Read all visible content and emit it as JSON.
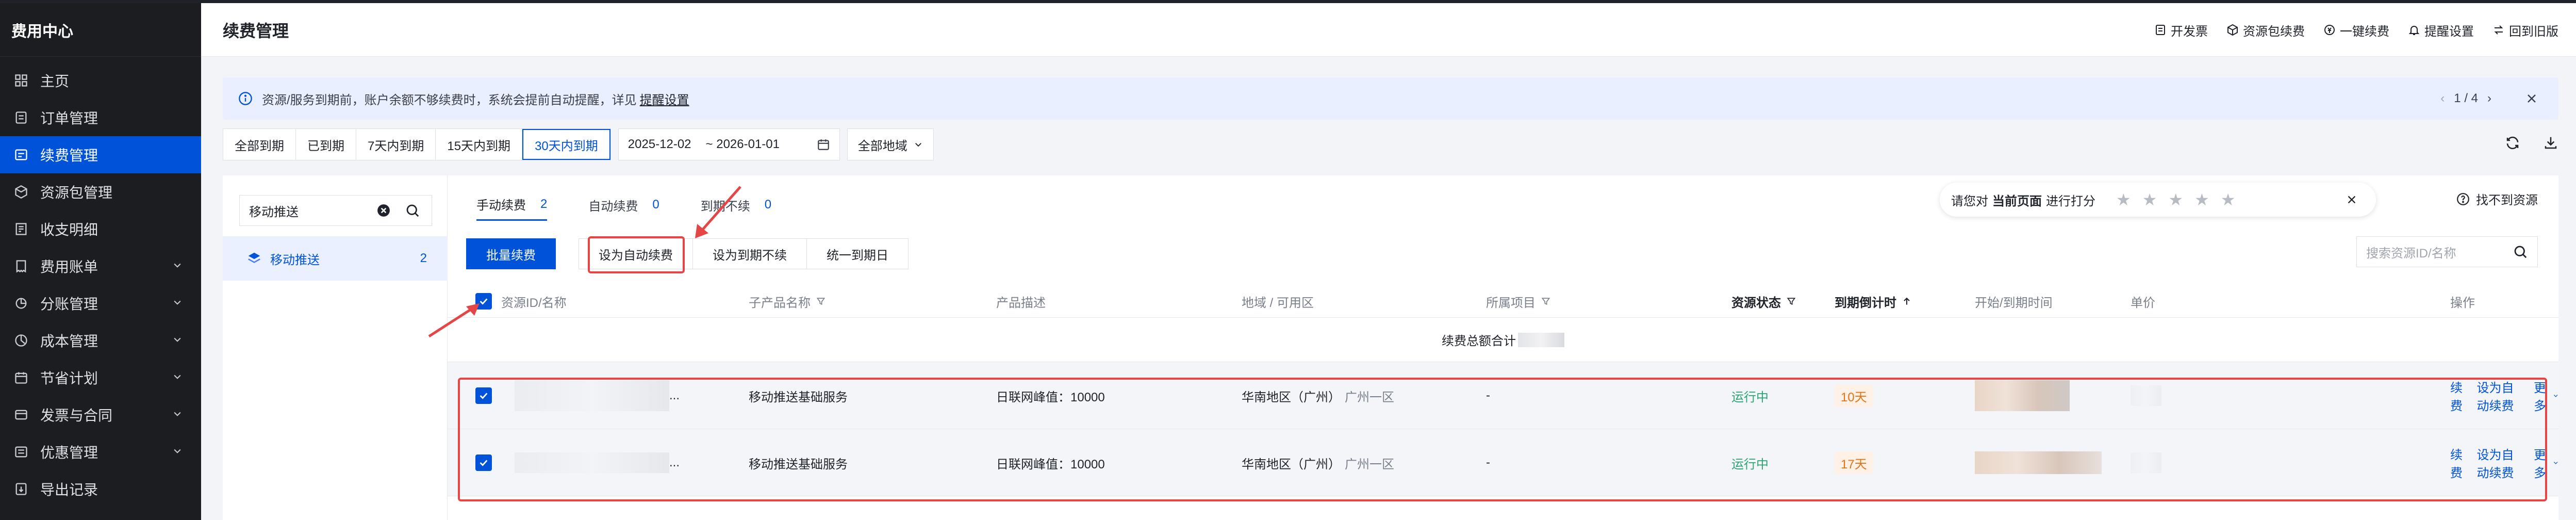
{
  "sidebar": {
    "title": "费用中心",
    "items": [
      {
        "label": "主页",
        "icon": "grid-icon"
      },
      {
        "label": "订单管理",
        "icon": "order-icon"
      },
      {
        "label": "续费管理",
        "icon": "renew-icon"
      },
      {
        "label": "资源包管理",
        "icon": "package-icon"
      },
      {
        "label": "收支明细",
        "icon": "ledger-icon"
      },
      {
        "label": "费用账单",
        "icon": "bill-icon"
      },
      {
        "label": "分账管理",
        "icon": "split-icon"
      },
      {
        "label": "成本管理",
        "icon": "cost-icon"
      },
      {
        "label": "节省计划",
        "icon": "plan-icon"
      },
      {
        "label": "发票与合同",
        "icon": "invoice-icon"
      },
      {
        "label": "优惠管理",
        "icon": "discount-icon"
      },
      {
        "label": "导出记录",
        "icon": "export-icon"
      }
    ]
  },
  "header": {
    "title": "续费管理",
    "actions": [
      "开发票",
      "资源包续费",
      "一键续费",
      "提醒设置",
      "回到旧版"
    ]
  },
  "notice": {
    "text": "资源/服务到期前，账户余额不够续费时，系统会提前自动提醒，详见",
    "link": "提醒设置",
    "pager": "1 / 4"
  },
  "filters": {
    "segments": [
      "全部到期",
      "已到期",
      "7天内到期",
      "15天内到期",
      "30天内到期"
    ],
    "active_segment": "30天内到期",
    "date_start": "2025-12-02",
    "date_end": "~ 2026-01-01",
    "region": "全部地域"
  },
  "left_panel": {
    "search_value": "移动推送",
    "product": "移动推送",
    "product_count": "2"
  },
  "tabs": [
    {
      "label": "手动续费",
      "count": "2"
    },
    {
      "label": "自动续费",
      "count": "0"
    },
    {
      "label": "到期不续",
      "count": "0"
    }
  ],
  "rating": {
    "prefix": "请您对",
    "bold": "当前页面",
    "suffix": "进行打分",
    "stars": 5
  },
  "not_found": "找不到资源",
  "buttons": {
    "batch": "批量续费",
    "set_auto": "设为自动续费",
    "set_no_renew": "设为到期不续",
    "unify_date": "统一到期日"
  },
  "search_placeholder": "搜索资源ID/名称",
  "table": {
    "headers": [
      "资源ID/名称",
      "子产品名称",
      "产品描述",
      "地域 / 可用区",
      "所属项目",
      "资源状态",
      "到期倒计时",
      "开始/到期时间",
      "单价",
      "操作"
    ],
    "summary": "续费总额合计",
    "rows": [
      {
        "id_suffix": "...",
        "sub_product": "移动推送基础服务",
        "desc": "日联网峰值：10000",
        "region": "华南地区（广州）",
        "zone": "广州一区",
        "project": "-",
        "status": "运行中",
        "countdown": "10天",
        "op_renew": "续费",
        "op_auto": "设为自动续费",
        "op_more": "更多"
      },
      {
        "id_suffix": "...",
        "sub_product": "移动推送基础服务",
        "desc": "日联网峰值：10000",
        "region": "华南地区（广州）",
        "zone": "广州一区",
        "project": "-",
        "status": "运行中",
        "countdown": "17天",
        "op_renew": "续费",
        "op_auto": "设为自动续费",
        "op_more": "更多"
      }
    ]
  },
  "colors": {
    "primary": "#0052d9",
    "sidebar_bg": "#1c1d21",
    "annotation": "#e54545",
    "status_green": "#2ba471",
    "countdown_orange": "#e37318"
  }
}
